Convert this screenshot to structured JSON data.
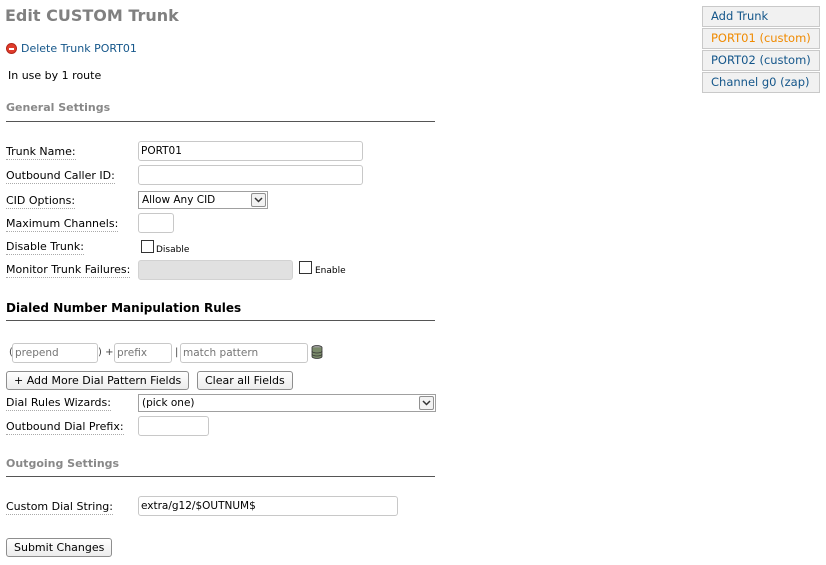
{
  "page": {
    "title": "Edit CUSTOM Trunk",
    "delete_link": "Delete Trunk PORT01",
    "in_use": "In use by 1 route"
  },
  "sections": {
    "general": "General Settings",
    "dial_rules": "Dialed Number Manipulation Rules",
    "outgoing": "Outgoing Settings"
  },
  "fields": {
    "trunk_name": {
      "label": "Trunk Name:",
      "value": "PORT01"
    },
    "outbound_cid": {
      "label": "Outbound Caller ID:",
      "value": ""
    },
    "cid_options": {
      "label": "CID Options:",
      "selected": "Allow Any CID"
    },
    "max_channels": {
      "label": "Maximum Channels:",
      "value": ""
    },
    "disable_trunk": {
      "label": "Disable Trunk:",
      "checkbox_label": "Disable",
      "checked": false
    },
    "monitor_failures": {
      "label": "Monitor Trunk Failures:",
      "value": "",
      "checkbox_label": "Enable",
      "checked": false
    }
  },
  "dial_pattern": {
    "prepend_placeholder": "prepend",
    "prefix_placeholder": "prefix",
    "match_placeholder": "match pattern",
    "open_paren": "(",
    "close_plus": ") +",
    "pipe": "|"
  },
  "buttons": {
    "add_more": "+ Add More Dial Pattern Fields",
    "clear_all": "Clear all Fields",
    "submit": "Submit Changes"
  },
  "dial_wizard": {
    "label": "Dial Rules Wizards:",
    "selected": "(pick one)"
  },
  "outbound_prefix": {
    "label": "Outbound Dial Prefix:",
    "value": ""
  },
  "custom_dial": {
    "label": "Custom Dial String:",
    "value": "extra/g12/$OUTNUM$"
  },
  "trunk_list": [
    {
      "label": "Add Trunk",
      "active": false
    },
    {
      "label": "PORT01 (custom)",
      "active": true
    },
    {
      "label": "PORT02 (custom)",
      "active": false
    },
    {
      "label": "Channel g0 (zap)",
      "active": false
    }
  ],
  "colors": {
    "link": "#14568a",
    "active": "#f08a00",
    "delete_icon": "#e03c2c"
  },
  "icons": {
    "delete": "minus-circle-icon",
    "dropdown": "chevron-down-icon",
    "trash": "trash-can-icon"
  }
}
